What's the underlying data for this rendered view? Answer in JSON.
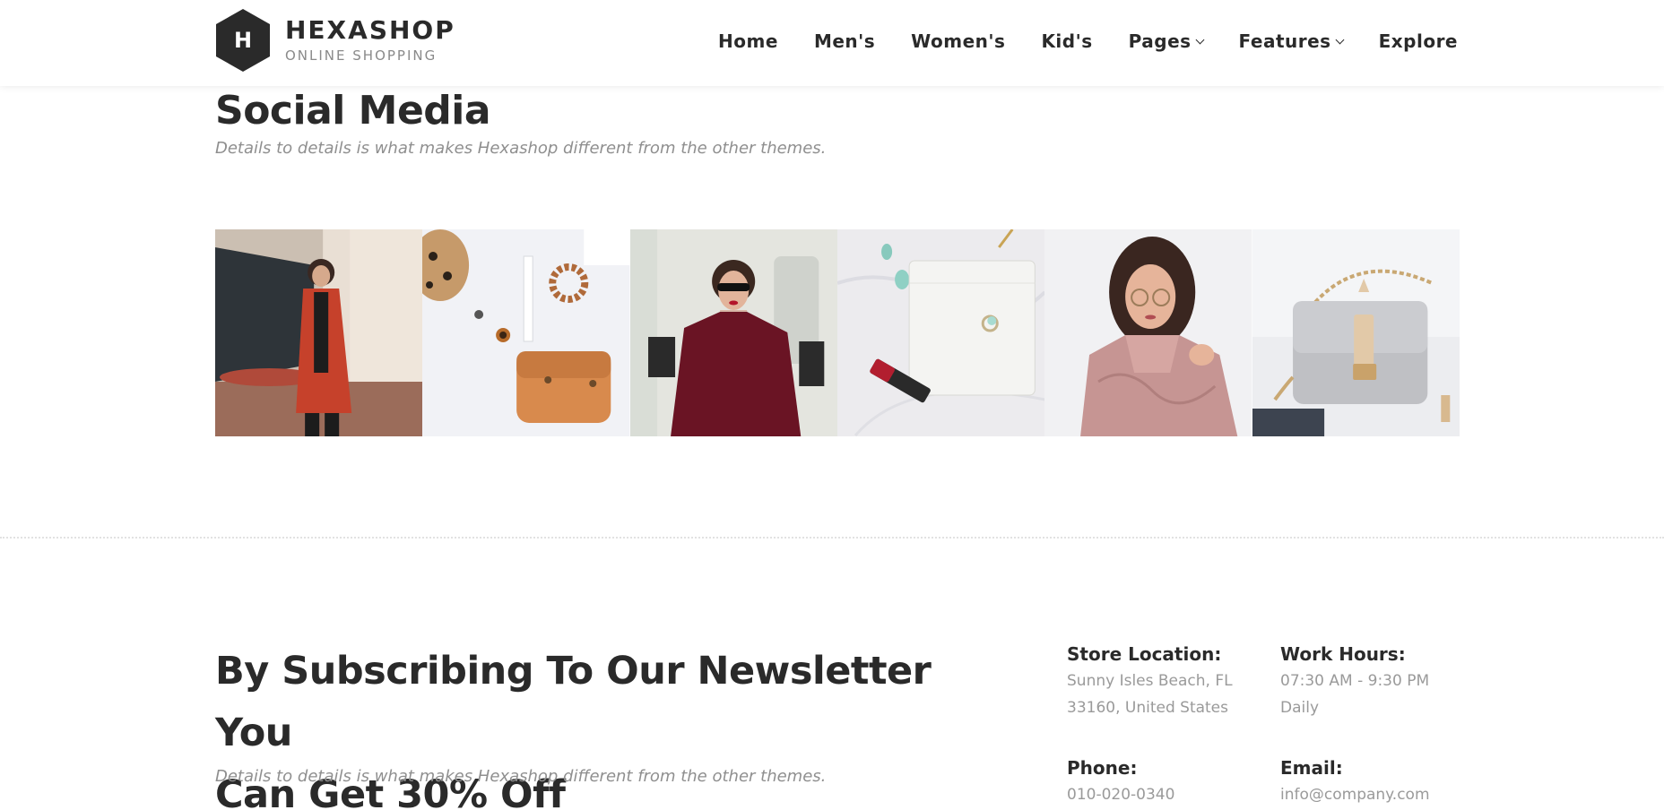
{
  "header": {
    "logo_letter": "H",
    "logo_name": "HEXASHOP",
    "logo_tagline": "ONLINE SHOPPING",
    "nav": [
      {
        "label": "Home",
        "has_dropdown": false
      },
      {
        "label": "Men's",
        "has_dropdown": false
      },
      {
        "label": "Women's",
        "has_dropdown": false
      },
      {
        "label": "Kid's",
        "has_dropdown": false
      },
      {
        "label": "Pages",
        "has_dropdown": true
      },
      {
        "label": "Features",
        "has_dropdown": true
      },
      {
        "label": "Explore",
        "has_dropdown": false
      }
    ]
  },
  "social": {
    "title": "Social Media",
    "subtitle": "Details to details is what makes Hexashop different from the other themes.",
    "images": [
      {
        "icon": "woman-red-coat-photo"
      },
      {
        "icon": "accessories-wallet-photo"
      },
      {
        "icon": "woman-sunglasses-photo"
      },
      {
        "icon": "clutch-lipstick-photo"
      },
      {
        "icon": "woman-pink-jacket-photo"
      },
      {
        "icon": "grey-handbag-photo"
      }
    ]
  },
  "newsletter": {
    "title_line1": "By Subscribing To Our Newsletter You",
    "title_line2": "Can Get 30% Off",
    "subtitle": "Details to details is what makes Hexashop different from the other themes.",
    "store_location": {
      "label": "Store Location:",
      "line1": "Sunny Isles Beach, FL",
      "line2": "33160, United States"
    },
    "work_hours": {
      "label": "Work Hours:",
      "line1": "07:30 AM - 9:30 PM",
      "line2": "Daily"
    },
    "phone": {
      "label": "Phone:",
      "value": "010-020-0340"
    },
    "email": {
      "label": "Email:",
      "value": "info@company.com"
    }
  },
  "colors": {
    "primary_text": "#2a2a2a",
    "muted_text": "#8f8f8f",
    "logo_bg": "#2a2a2a"
  }
}
